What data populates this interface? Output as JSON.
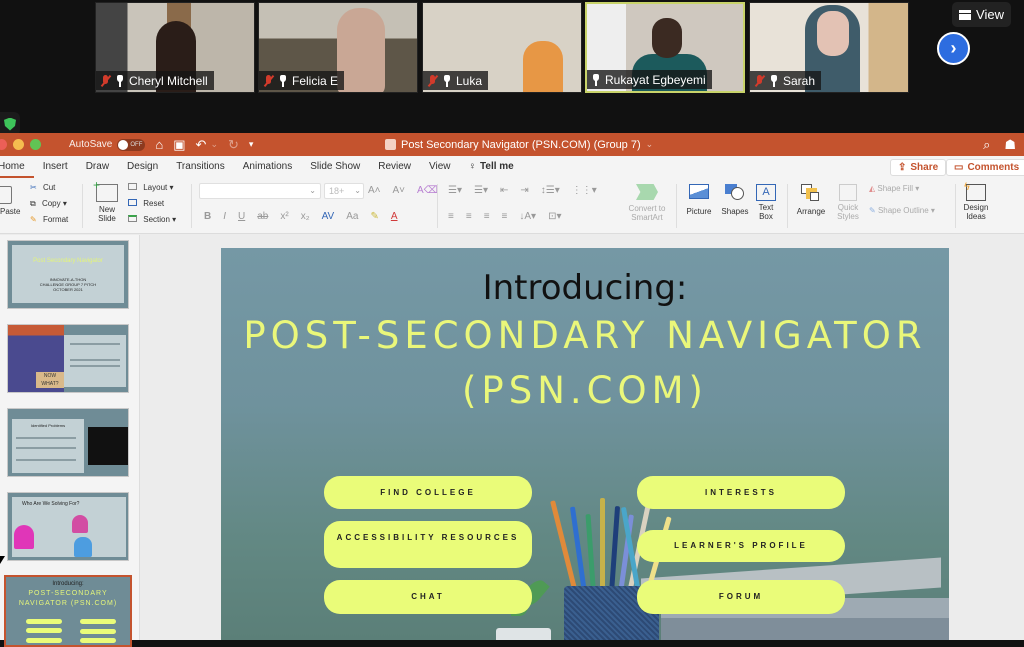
{
  "zoom": {
    "participants": [
      {
        "name": "Cheryl Mitchell",
        "muted": true,
        "active_speaker": false
      },
      {
        "name": "Felicia E",
        "muted": true,
        "active_speaker": false
      },
      {
        "name": "Luka",
        "muted": true,
        "active_speaker": false
      },
      {
        "name": "Rukayat Egbeyemi",
        "muted": false,
        "active_speaker": true
      },
      {
        "name": "Sarah",
        "muted": true,
        "active_speaker": false
      }
    ],
    "view_label": "View",
    "next_page_icon": "chevron-right-icon",
    "security_icon": "shield-check-icon"
  },
  "powerpoint": {
    "autosave_label": "AutoSave",
    "autosave_state": "OFF",
    "document_title": "Post Secondary Navigator (PSN.COM) (Group 7)",
    "tabs": [
      "Home",
      "Insert",
      "Draw",
      "Design",
      "Transitions",
      "Animations",
      "Slide Show",
      "Review",
      "View"
    ],
    "active_tab": "Home",
    "tell_me": "Tell me",
    "share_label": "Share",
    "comments_label": "Comments",
    "ribbon": {
      "paste": "Paste",
      "cut": "Cut",
      "copy": "Copy",
      "format": "Format",
      "new_slide_line1": "New",
      "new_slide_line2": "Slide",
      "layout": "Layout",
      "reset": "Reset",
      "section": "Section",
      "font_name": "",
      "font_size": "18+",
      "convert_line1": "Convert to",
      "convert_line2": "SmartArt",
      "picture": "Picture",
      "shapes": "Shapes",
      "text_box_line1": "Text",
      "text_box_line2": "Box",
      "arrange": "Arrange",
      "quick_styles_line1": "Quick",
      "quick_styles_line2": "Styles",
      "shape_fill": "Shape Fill",
      "shape_outline": "Shape Outline",
      "design_ideas_line1": "Design",
      "design_ideas_line2": "Ideas"
    },
    "thumbnails": [
      {
        "title": "Post Secondary Navigator",
        "subtitle": "INNOVATE-A-THON CHALLENGE GROUP 7 PITCH OCTOBER 2021"
      },
      {
        "title": "",
        "sign": "NOW WHAT?"
      },
      {
        "title": "Identified Problems"
      },
      {
        "title": "Who Are We Solving For?"
      },
      {
        "title": "Introducing:",
        "subtitle": "POST-SECONDARY NAVIGATOR (PSN.COM)",
        "selected": true
      }
    ],
    "slide": {
      "intro": "Introducing:",
      "title": "POST-SECONDARY NAVIGATOR",
      "subtitle": "(PSN.COM)",
      "buttons": [
        "FIND COLLEGE",
        "INTERESTS",
        "ACCESSIBILITY RESOURCES",
        "LEARNER'S PROFILE",
        "CHAT",
        "FORUM"
      ],
      "colors": {
        "accent": "#eafc79",
        "background": "#7598a5",
        "intro_text": "#111111"
      }
    },
    "colors": {
      "titlebar": "#c4532e",
      "ribbon": "#f4f4f4"
    }
  }
}
